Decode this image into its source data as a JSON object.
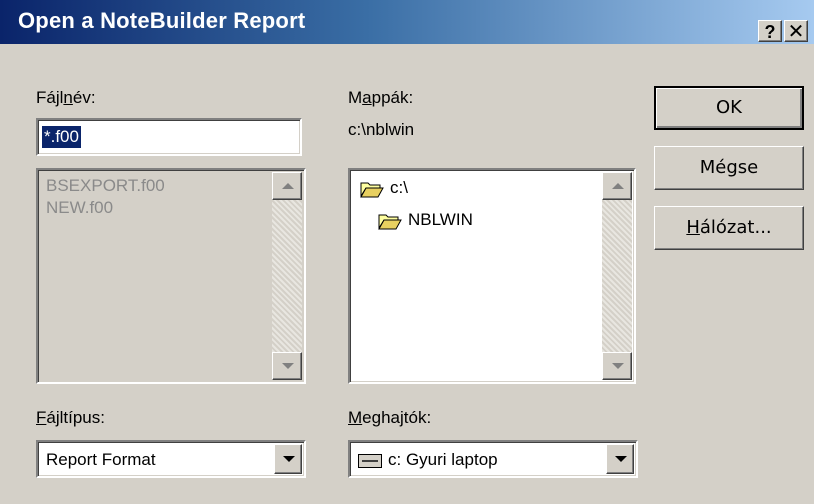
{
  "window": {
    "title": "Open a NoteBuilder Report",
    "help_label": "?",
    "close_label": "✕"
  },
  "filename": {
    "label_pre": "Fájl",
    "label_u": "n",
    "label_post": "év:",
    "value": "*.f00"
  },
  "files": {
    "items": [
      "BSEXPORT.f00",
      "NEW.f00"
    ]
  },
  "folders": {
    "label_pre": "M",
    "label_u": "a",
    "label_post": "ppák:",
    "current_path": "c:\\nblwin",
    "items": [
      "c:\\",
      "NBLWIN"
    ]
  },
  "filetype": {
    "label_u": "F",
    "label_post": "ájltípus:",
    "value": "Report Format"
  },
  "drives": {
    "label_u": "M",
    "label_post": "eghajtók:",
    "value": "c: Gyuri laptop"
  },
  "buttons": {
    "ok": "OK",
    "cancel": "Mégse",
    "network_u": "H",
    "network_post": "álózat..."
  },
  "icons": {
    "folder": "folder-open-icon",
    "drive": "hard-drive-icon"
  },
  "colors": {
    "title_start": "#0a246a",
    "title_end": "#a6caf0",
    "face": "#d4d0c8",
    "selection": "#0a246a"
  }
}
